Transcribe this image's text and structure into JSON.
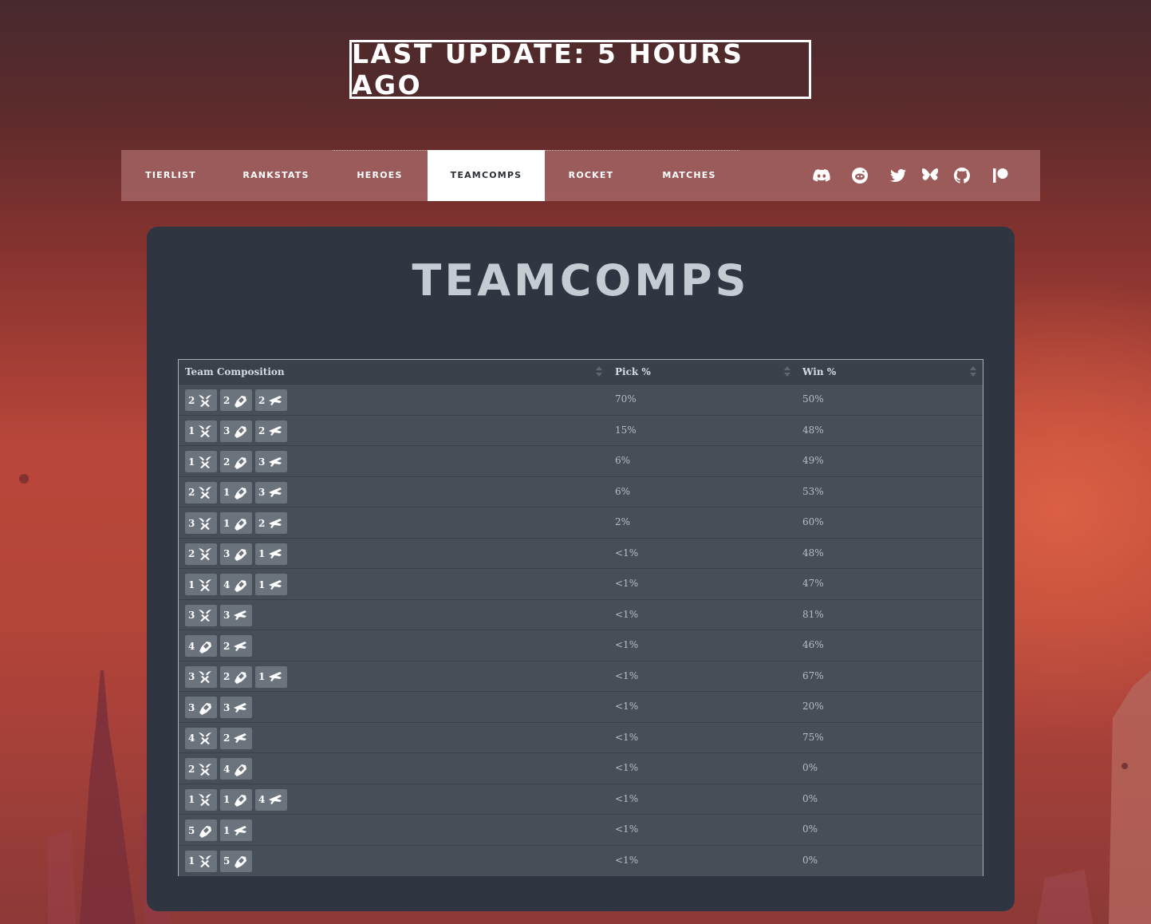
{
  "header": {
    "update_text": "LAST UPDATE: 5 HOURS AGO"
  },
  "nav": {
    "items": [
      {
        "label": "TIERLIST",
        "active": false
      },
      {
        "label": "RANKSTATS",
        "active": false
      },
      {
        "label": "HEROES",
        "active": false
      },
      {
        "label": "TEAMCOMPS",
        "active": true
      },
      {
        "label": "ROCKET",
        "active": false
      },
      {
        "label": "MATCHES",
        "active": false
      }
    ],
    "social_icons": [
      "discord-icon",
      "reddit-icon",
      "twitter-icon",
      "bluesky-icon",
      "github-icon",
      "patreon-icon"
    ]
  },
  "page": {
    "title": "TEAMCOMPS"
  },
  "table": {
    "columns": [
      "Team Composition",
      "Pick %",
      "Win %"
    ],
    "role_icons": {
      "vanguard": "vanguard-role-icon",
      "duelist": "duelist-role-icon",
      "strategist": "strategist-role-icon"
    },
    "rows": [
      {
        "comp": [
          [
            "2",
            "vanguard"
          ],
          [
            "2",
            "duelist"
          ],
          [
            "2",
            "strategist"
          ]
        ],
        "pick": "70%",
        "win": "50%"
      },
      {
        "comp": [
          [
            "1",
            "vanguard"
          ],
          [
            "3",
            "duelist"
          ],
          [
            "2",
            "strategist"
          ]
        ],
        "pick": "15%",
        "win": "48%"
      },
      {
        "comp": [
          [
            "1",
            "vanguard"
          ],
          [
            "2",
            "duelist"
          ],
          [
            "3",
            "strategist"
          ]
        ],
        "pick": "6%",
        "win": "49%"
      },
      {
        "comp": [
          [
            "2",
            "vanguard"
          ],
          [
            "1",
            "duelist"
          ],
          [
            "3",
            "strategist"
          ]
        ],
        "pick": "6%",
        "win": "53%"
      },
      {
        "comp": [
          [
            "3",
            "vanguard"
          ],
          [
            "1",
            "duelist"
          ],
          [
            "2",
            "strategist"
          ]
        ],
        "pick": "2%",
        "win": "60%"
      },
      {
        "comp": [
          [
            "2",
            "vanguard"
          ],
          [
            "3",
            "duelist"
          ],
          [
            "1",
            "strategist"
          ]
        ],
        "pick": "<1%",
        "win": "48%"
      },
      {
        "comp": [
          [
            "1",
            "vanguard"
          ],
          [
            "4",
            "duelist"
          ],
          [
            "1",
            "strategist"
          ]
        ],
        "pick": "<1%",
        "win": "47%"
      },
      {
        "comp": [
          [
            "3",
            "vanguard"
          ],
          [
            "3",
            "strategist"
          ]
        ],
        "pick": "<1%",
        "win": "81%"
      },
      {
        "comp": [
          [
            "4",
            "duelist"
          ],
          [
            "2",
            "strategist"
          ]
        ],
        "pick": "<1%",
        "win": "46%"
      },
      {
        "comp": [
          [
            "3",
            "vanguard"
          ],
          [
            "2",
            "duelist"
          ],
          [
            "1",
            "strategist"
          ]
        ],
        "pick": "<1%",
        "win": "67%"
      },
      {
        "comp": [
          [
            "3",
            "duelist"
          ],
          [
            "3",
            "strategist"
          ]
        ],
        "pick": "<1%",
        "win": "20%"
      },
      {
        "comp": [
          [
            "4",
            "vanguard"
          ],
          [
            "2",
            "strategist"
          ]
        ],
        "pick": "<1%",
        "win": "75%"
      },
      {
        "comp": [
          [
            "2",
            "vanguard"
          ],
          [
            "4",
            "duelist"
          ]
        ],
        "pick": "<1%",
        "win": "0%"
      },
      {
        "comp": [
          [
            "1",
            "vanguard"
          ],
          [
            "1",
            "duelist"
          ],
          [
            "4",
            "strategist"
          ]
        ],
        "pick": "<1%",
        "win": "0%"
      },
      {
        "comp": [
          [
            "5",
            "duelist"
          ],
          [
            "1",
            "strategist"
          ]
        ],
        "pick": "<1%",
        "win": "0%"
      },
      {
        "comp": [
          [
            "1",
            "vanguard"
          ],
          [
            "5",
            "duelist"
          ]
        ],
        "pick": "<1%",
        "win": "0%"
      }
    ]
  }
}
